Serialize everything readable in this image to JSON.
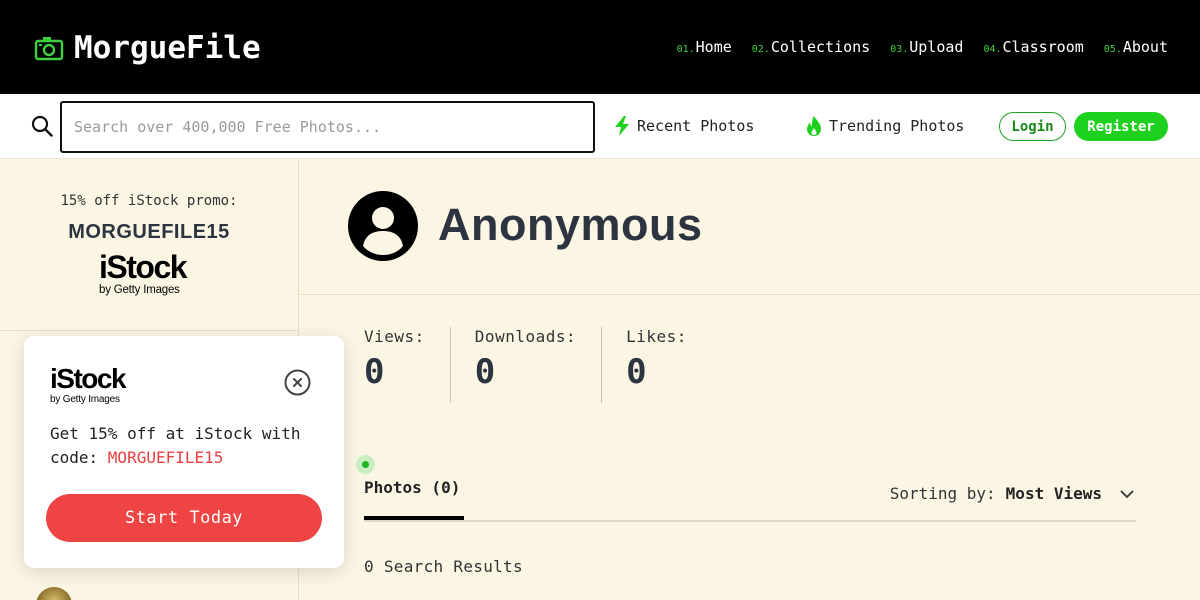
{
  "brand": {
    "name": "MorgueFile",
    "accent": "#3fd13f"
  },
  "nav": [
    {
      "num": "01.",
      "label": "Home"
    },
    {
      "num": "02.",
      "label": "Collections"
    },
    {
      "num": "03.",
      "label": "Upload"
    },
    {
      "num": "04.",
      "label": "Classroom"
    },
    {
      "num": "05.",
      "label": "About"
    }
  ],
  "search": {
    "placeholder": "Search over 400,000 Free Photos...",
    "value": ""
  },
  "quick_links": {
    "recent": "Recent Photos",
    "trending": "Trending Photos"
  },
  "auth": {
    "login": "Login",
    "register": "Register"
  },
  "sidebar": {
    "promo_line": "15% off iStock promo:",
    "promo_code": "MORGUEFILE15",
    "logo_word": "iStock",
    "logo_sub": "by Getty Images"
  },
  "popup": {
    "logo_word": "iStock",
    "logo_sub": "by Getty Images",
    "text": "Get 15% off at iStock with code: ",
    "code": "MORGUEFILE15",
    "button": "Start Today"
  },
  "profile": {
    "name": "Anonymous"
  },
  "stats": [
    {
      "label": "Views:",
      "value": "0"
    },
    {
      "label": "Downloads:",
      "value": "0"
    },
    {
      "label": "Likes:",
      "value": "0"
    }
  ],
  "tabs": {
    "photos": "Photos (0)"
  },
  "sorting": {
    "label": "Sorting by:",
    "value": "Most Views"
  },
  "results": "0 Search Results",
  "colors": {
    "register": "#1fd11f",
    "popup_button": "#ee4444",
    "promo_code": "#ec3e3e",
    "background": "#fbf6e4"
  }
}
